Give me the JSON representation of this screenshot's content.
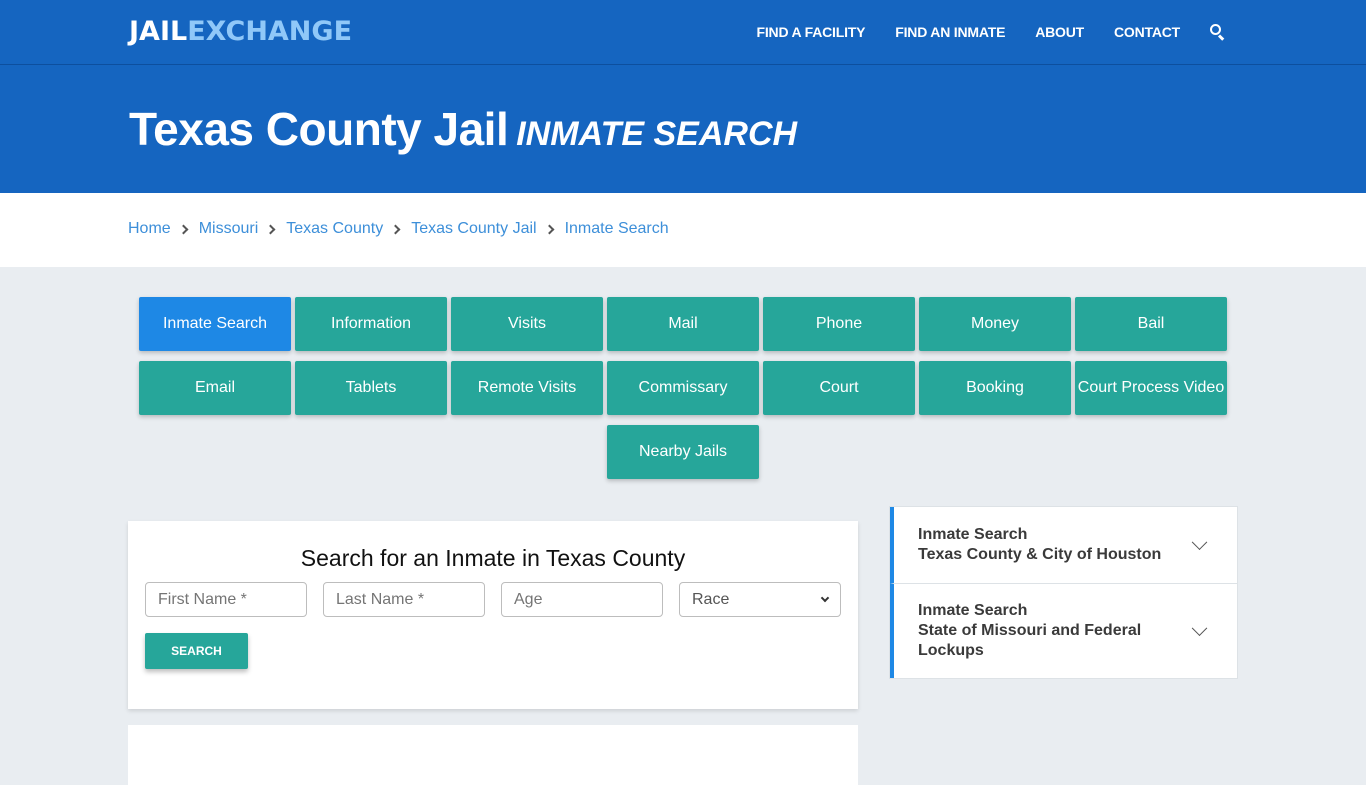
{
  "header": {
    "logo_part1": "JAIL",
    "logo_part2": "EXCHANGE",
    "nav": [
      "FIND A FACILITY",
      "FIND AN INMATE",
      "ABOUT",
      "CONTACT"
    ],
    "search_icon": "search-icon"
  },
  "hero": {
    "title": "Texas County Jail",
    "subtitle": "INMATE SEARCH"
  },
  "breadcrumb": [
    "Home",
    "Missouri",
    "Texas County",
    "Texas County Jail",
    "Inmate Search"
  ],
  "buttons": [
    {
      "label": "Inmate Search",
      "active": true
    },
    {
      "label": "Information"
    },
    {
      "label": "Visits"
    },
    {
      "label": "Mail"
    },
    {
      "label": "Phone"
    },
    {
      "label": "Money"
    },
    {
      "label": "Bail"
    },
    {
      "label": "Email"
    },
    {
      "label": "Tablets"
    },
    {
      "label": "Remote Visits"
    },
    {
      "label": "Commissary"
    },
    {
      "label": "Court"
    },
    {
      "label": "Booking"
    },
    {
      "label": "Court Process Video"
    },
    {
      "label": "Nearby Jails"
    }
  ],
  "search_form": {
    "title": "Search for an Inmate in Texas County",
    "first_name_placeholder": "First Name *",
    "last_name_placeholder": "Last Name *",
    "age_placeholder": "Age",
    "race_selected": "Race",
    "submit_label": "SEARCH"
  },
  "sidebar": {
    "items": [
      {
        "line1": "Inmate Search",
        "line2": "Texas County & City of Houston"
      },
      {
        "line1": "Inmate Search",
        "line2": "State of Missouri and Federal Lockups"
      }
    ]
  },
  "colors": {
    "brand_blue": "#1565c0",
    "logo_accent": "#90c8f8",
    "teal": "#26a69a",
    "active_blue": "#1e88e5",
    "link": "#3d8fd9"
  }
}
